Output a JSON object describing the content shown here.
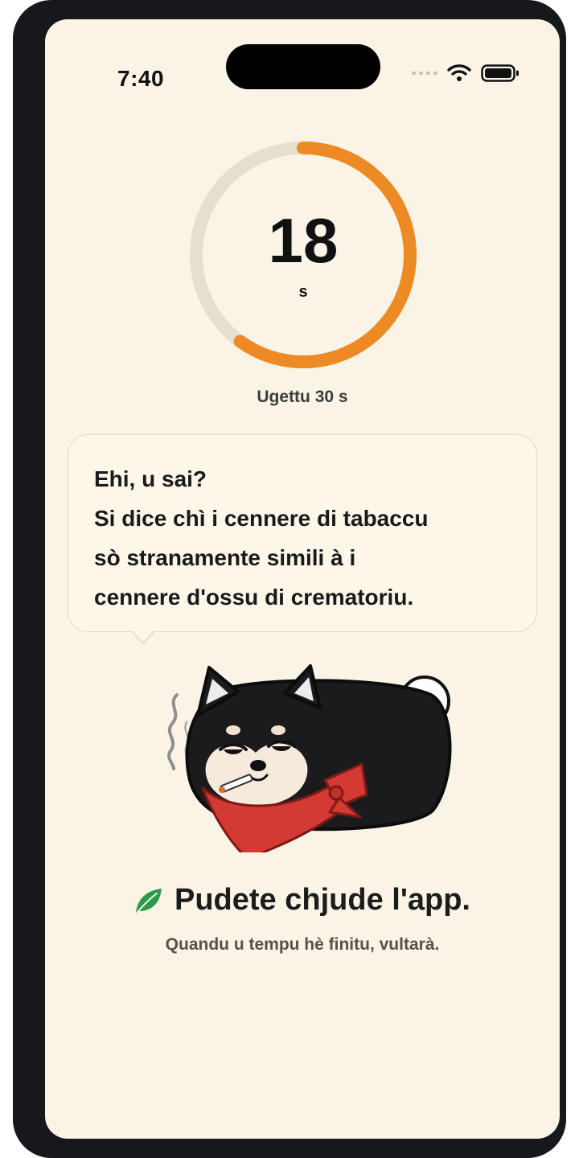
{
  "status_bar": {
    "time": "7:40",
    "icons": [
      "signal-icon",
      "wifi-icon",
      "battery-icon"
    ]
  },
  "timer": {
    "value": "18",
    "unit": "s",
    "caption": "Ugettu 30 s",
    "progress_fraction": 0.6,
    "colors": {
      "track": "#e6dfd0",
      "fill": "#ee8a24"
    }
  },
  "message": {
    "lines": [
      "Ehi, u sai?",
      "Si dice chì i cennere di tabaccu",
      "sò stranamente simili à i",
      "cennere d'ossu di crematoriu."
    ]
  },
  "mascot": {
    "icon": "smoking-dog-illustration"
  },
  "footer": {
    "icon": "leaf-icon",
    "title": "Pudete chjude l'app.",
    "subtitle": "Quandu u tempu hè finitu, vultarà."
  },
  "colors": {
    "background": "#faf4e6",
    "accent": "#ee8a24",
    "leaf": "#2c9a4c",
    "bandana": "#d23a33"
  }
}
